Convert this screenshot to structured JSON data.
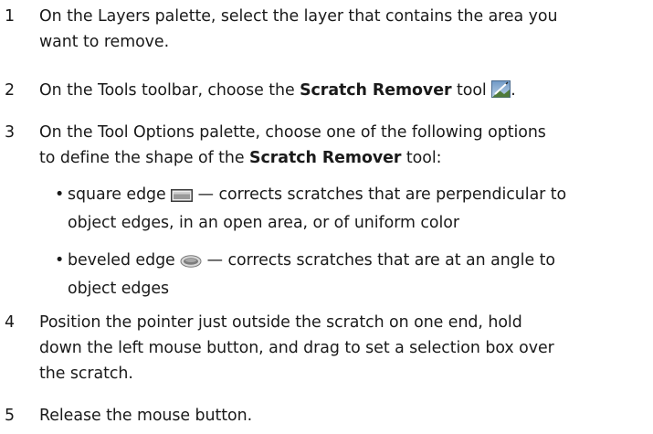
{
  "steps": [
    {
      "number": "1",
      "lines": [
        "On the Layers palette, select the layer that contains the area you",
        "want to remove."
      ]
    },
    {
      "number": "2",
      "pre": "On the Tools toolbar, choose the ",
      "bold": "Scratch Remover",
      "post": " tool",
      "end": ".",
      "icon": "scratch-remover-tool-icon"
    },
    {
      "number": "3",
      "line1": "On the Tool Options palette, choose one of the following options",
      "line2_pre": "to define the shape of the ",
      "line2_bold": "Scratch Remover",
      "line2_post": " tool:"
    },
    {
      "number": "4",
      "lines": [
        "Position the pointer just outside the scratch on one end, hold",
        "down the left mouse button, and drag to set a selection box over",
        "the scratch."
      ]
    },
    {
      "number": "5",
      "lines": [
        "Release the mouse button."
      ]
    }
  ],
  "options": [
    {
      "bullet": "•",
      "pre": "square edge ",
      "icon": "square-edge-icon",
      "line1_post": " — corrects scratches that are perpendicular to",
      "line2": "object edges, in an open area, or of uniform color"
    },
    {
      "bullet": "•",
      "pre": "beveled edge ",
      "icon": "beveled-edge-icon",
      "line1_post": " — corrects scratches that are at an angle to",
      "line2": "object edges"
    }
  ]
}
